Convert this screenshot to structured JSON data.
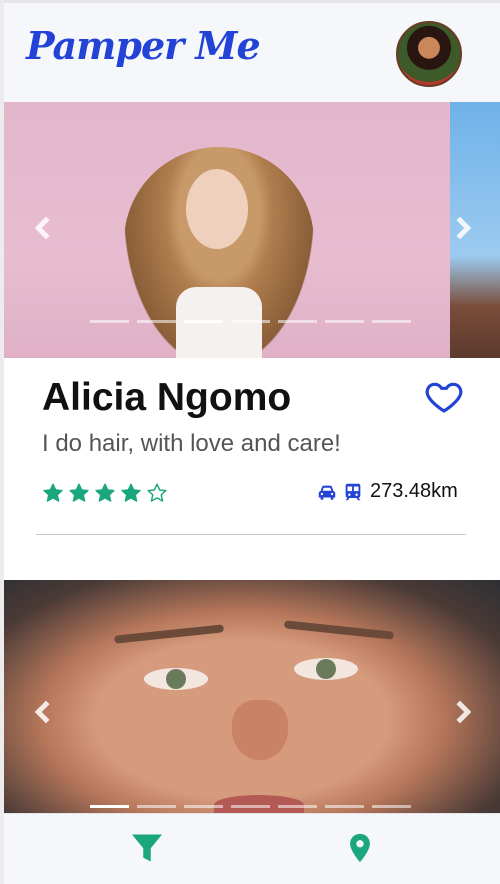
{
  "app": {
    "title": "Pamper Me"
  },
  "header": {
    "profile_avatar_alt": "profile avatar"
  },
  "cards": [
    {
      "name": "Alicia Ngomo",
      "tagline": "I do hair, with love and care!",
      "rating": 4,
      "rating_max": 5,
      "distance": "273.48km",
      "travel_modes": [
        "car-icon",
        "train-icon"
      ],
      "carousel_count": 7,
      "carousel_active": 2,
      "favorited": false
    },
    {
      "carousel_count": 7,
      "carousel_active": 0
    }
  ],
  "nav": {
    "items": [
      "filter-icon",
      "location-pin-icon"
    ]
  },
  "colors": {
    "brand": "#2243d6",
    "accent_green": "#1aa77e",
    "background": "#f5f7fa"
  }
}
